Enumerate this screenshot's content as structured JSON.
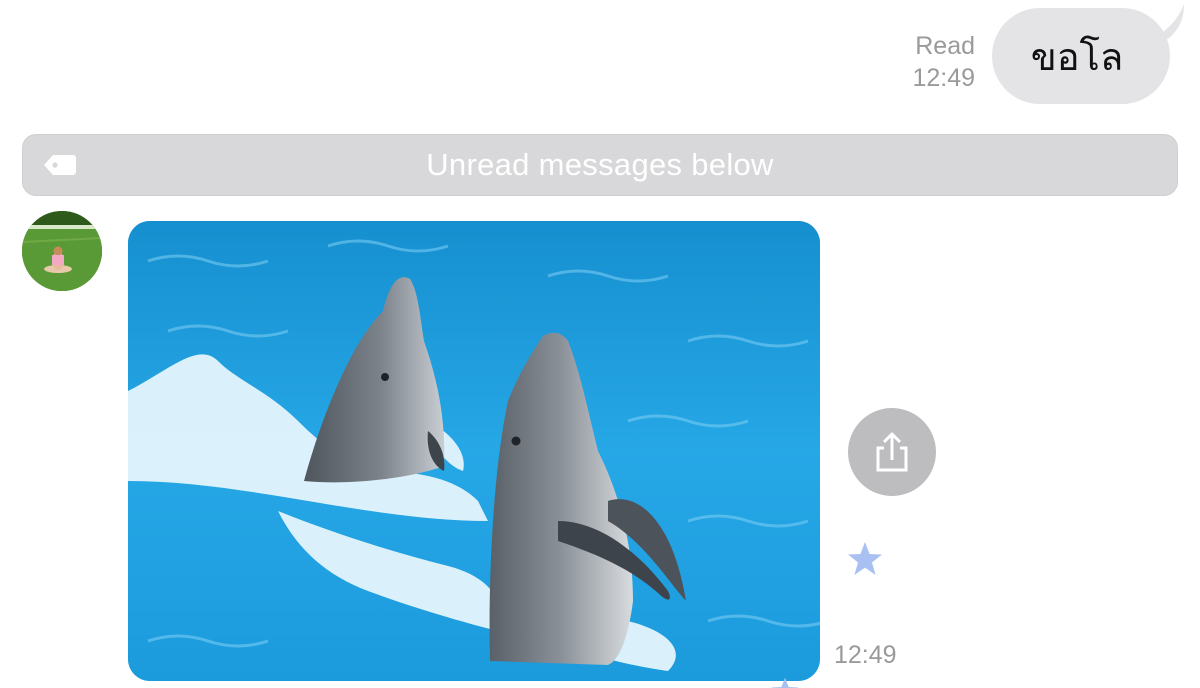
{
  "outgoing_message": {
    "status": "Read",
    "time": "12:49",
    "text": "ขอโล"
  },
  "unread_divider": {
    "label": "Unread messages below",
    "icon": "tag-icon"
  },
  "incoming_message": {
    "avatar_icon": "avatar",
    "photo_description_icon": "dolphins-photo",
    "share_icon": "share-icon",
    "star_icon": "star-icon",
    "time": "12:49"
  },
  "colors": {
    "bubble": "#e4e4e6",
    "divider": "#d8d8da",
    "meta_text": "#9a9a9a",
    "share_button": "#bdbdbf",
    "star": "#a9c1f2",
    "water": "#1f9ad6"
  }
}
